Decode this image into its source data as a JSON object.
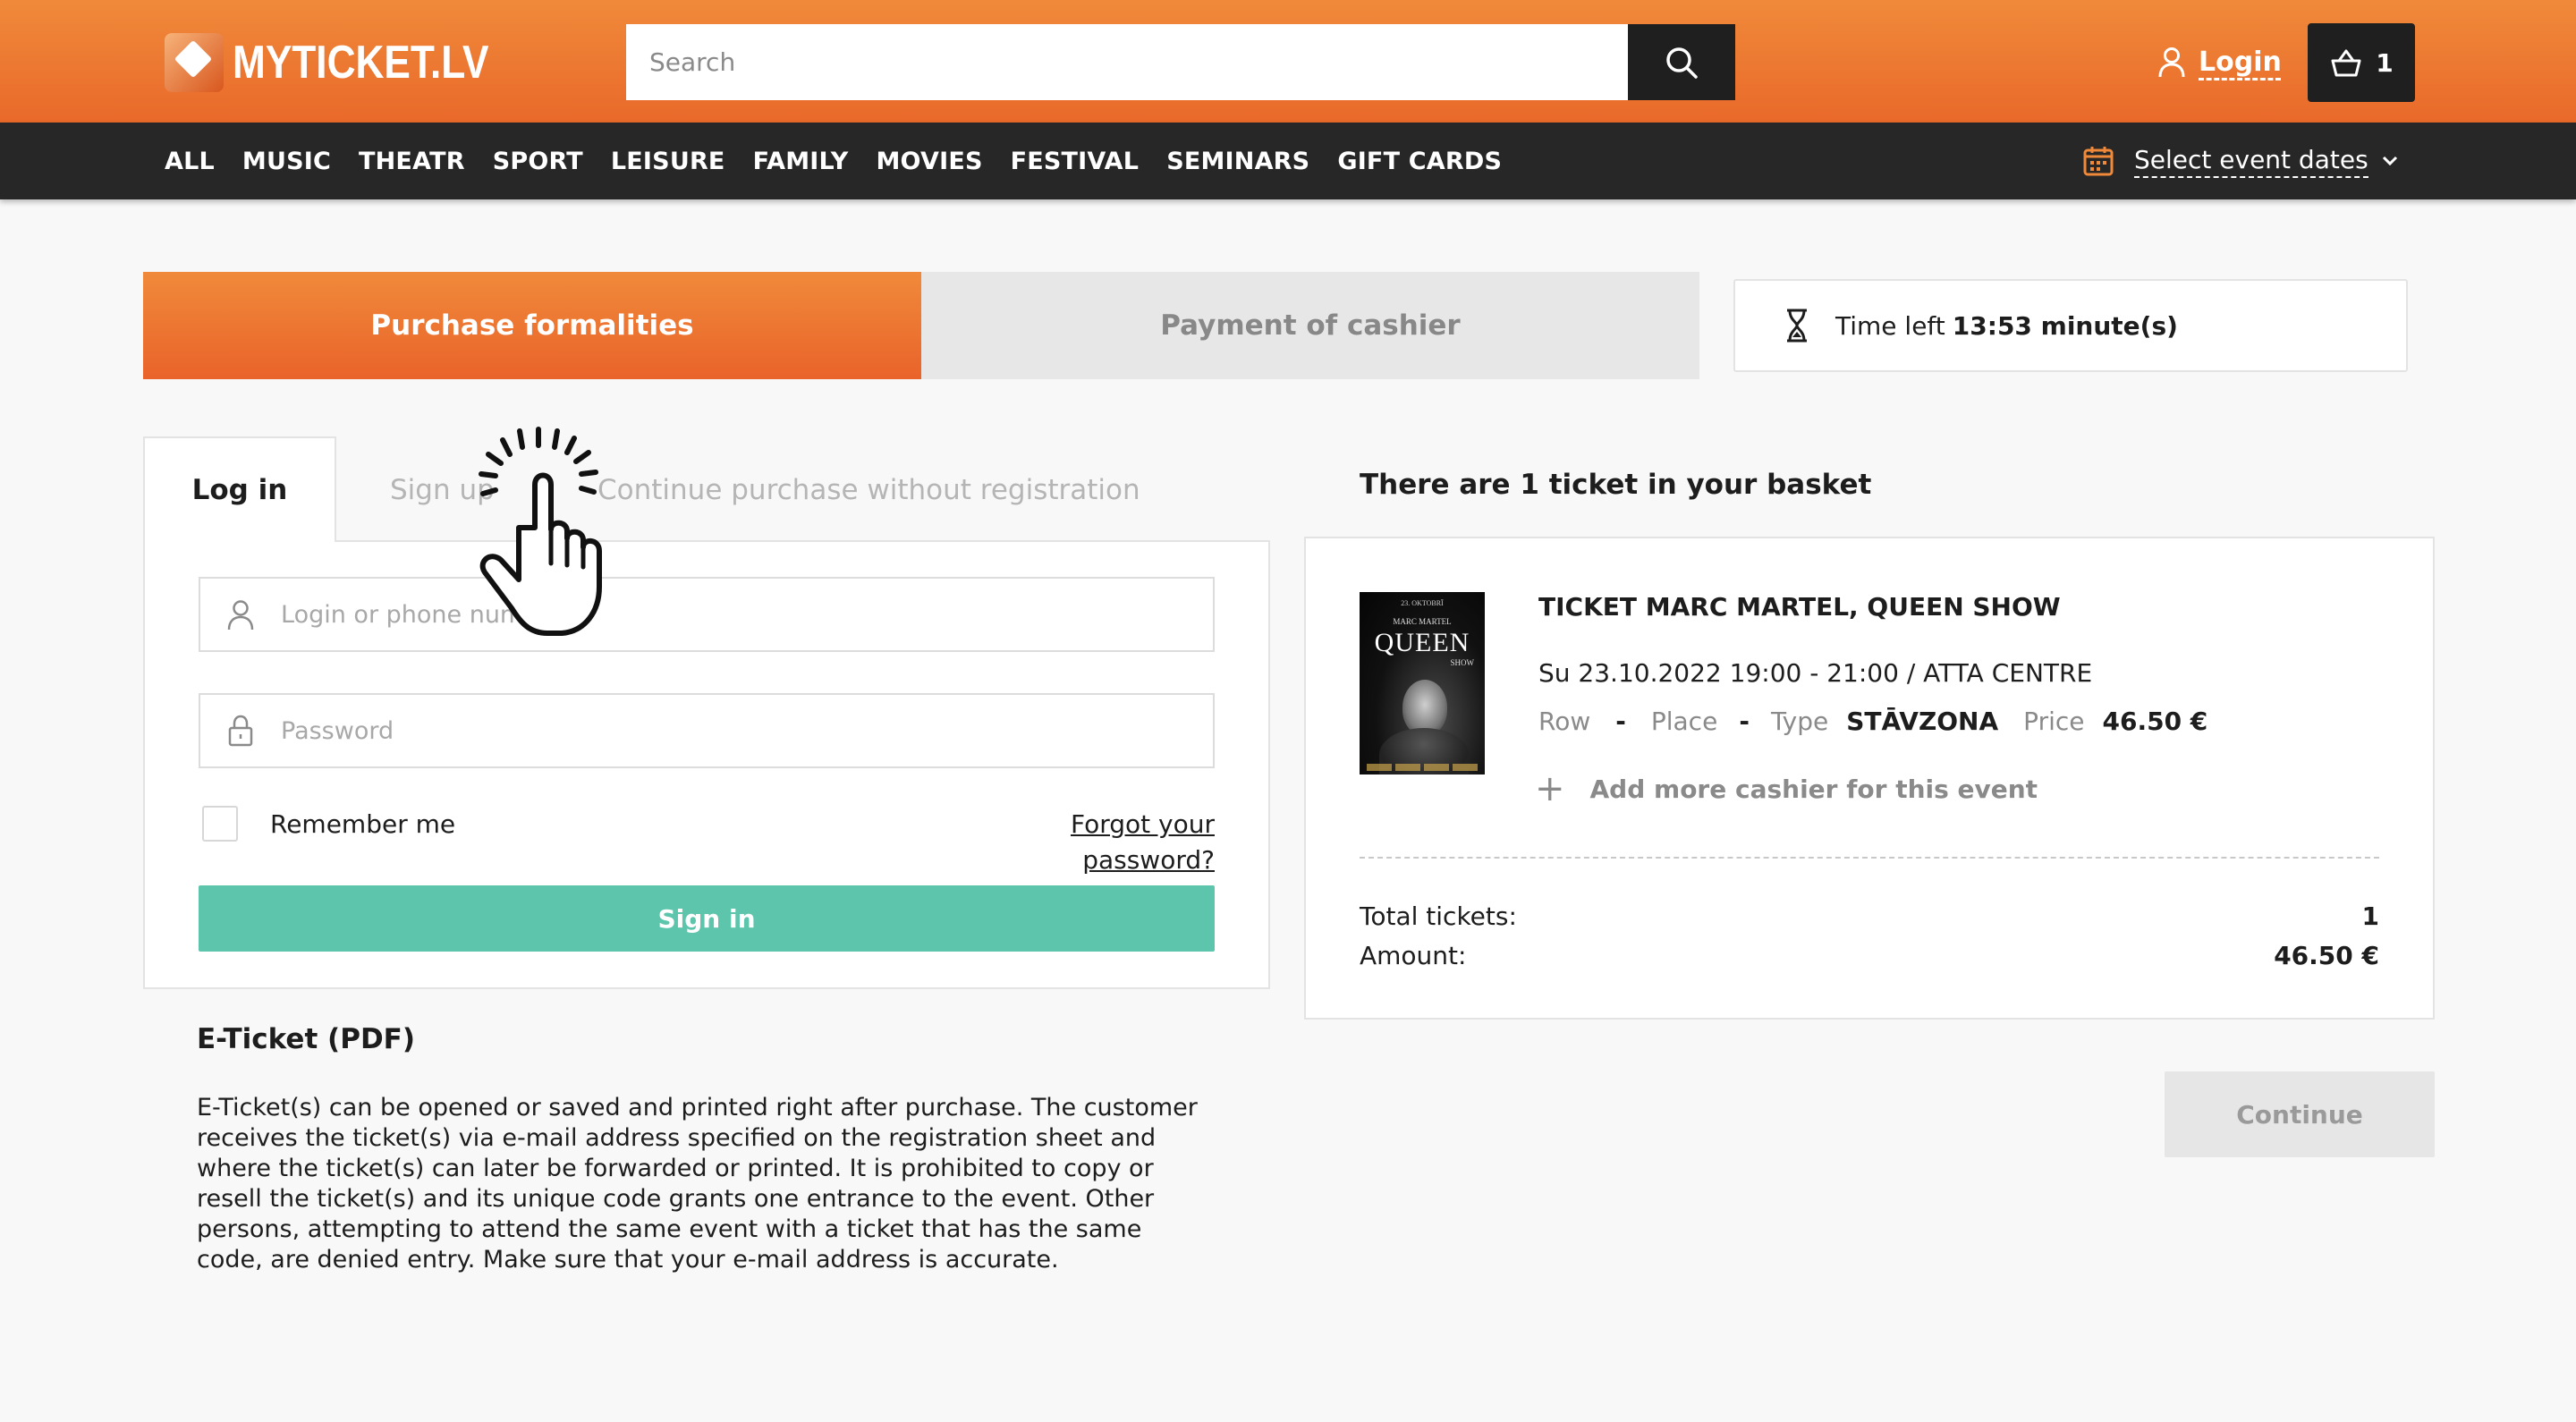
{
  "header": {
    "logo_text": "MYTICKET.LV",
    "search_placeholder": "Search",
    "login_label": "Login",
    "basket_count": "1",
    "brand_color": "#e9692a",
    "dark_color": "#1f1f1f"
  },
  "nav": {
    "items": [
      "ALL",
      "MUSIC",
      "THEATR",
      "SPORT",
      "LEISURE",
      "FAMILY",
      "MOVIES",
      "FESTIVAL",
      "SEMINARS",
      "GIFT CARDS"
    ],
    "date_picker_label": "Select event dates"
  },
  "steps": {
    "step1": "Purchase formalities",
    "step2": "Payment of cashier"
  },
  "timer": {
    "label": "Time left",
    "value": "13:53 minute(s)"
  },
  "auth": {
    "tabs": {
      "login": "Log in",
      "signup": "Sign up",
      "guest": "Continue purchase without registration"
    },
    "login_placeholder": "Login or phone number",
    "password_placeholder": "Password",
    "remember_me": "Remember me",
    "forgot_password": "Forgot your password?",
    "sign_in_button": "Sign in",
    "sign_in_color": "#5cc5ac"
  },
  "eticket": {
    "title": "E-Ticket (PDF)",
    "text": "E-Ticket(s) can be opened or saved and printed right after purchase. The customer receives the ticket(s) via e-mail address specified on the registration sheet and where the ticket(s) can later be forwarded or printed. It is prohibited to copy or resell the ticket(s) and its unique code grants one entrance to the event. Other persons, attempting to attend the same event with a ticket that has the same code, are denied entry. Make sure that your e-mail address is accurate."
  },
  "basket": {
    "title": "There are 1 ticket in your basket",
    "poster": {
      "line1": "23. OKTOBRĪ",
      "line2": "MARC MARTEL",
      "line3": "QUEEN",
      "line4": "SHOW"
    },
    "event_name": "TICKET MARC MARTEL, QUEEN SHOW",
    "event_datetime": "Su 23.10.2022 19:00 - 21:00 / ATTA CENTRE",
    "row_label": "Row",
    "row_value": "-",
    "place_label": "Place",
    "place_value": "-",
    "type_label": "Type",
    "type_value": "STĀVZONA",
    "price_label": "Price",
    "price_value": "46.50 €",
    "add_more": "Add more cashier for this event",
    "total_tickets_label": "Total tickets:",
    "total_tickets_value": "1",
    "amount_label": "Amount:",
    "amount_value": "46.50 €",
    "continue_button": "Continue"
  }
}
